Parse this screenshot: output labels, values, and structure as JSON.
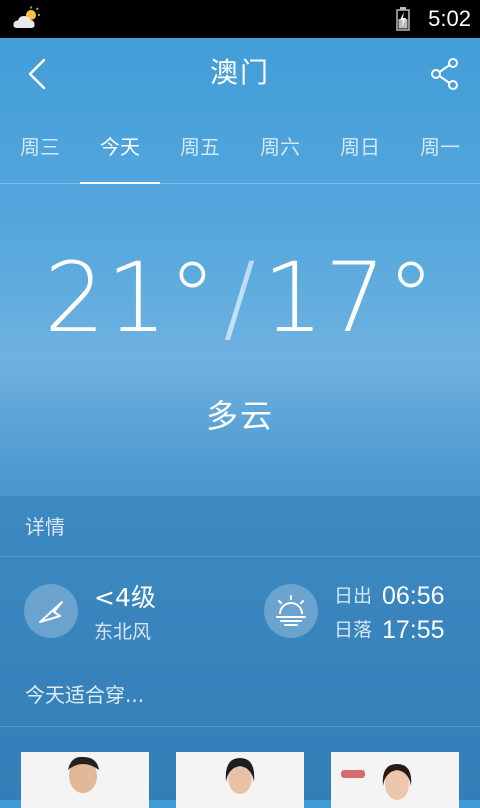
{
  "status_bar": {
    "time": "5:02",
    "weather_icon": "cloud-sun-icon",
    "battery_icon": "battery-charging-icon"
  },
  "header": {
    "city": "澳门",
    "back_icon": "back-arrow-icon",
    "share_icon": "share-icon"
  },
  "tabs": [
    {
      "label": "周三",
      "active": false
    },
    {
      "label": "今天",
      "active": true
    },
    {
      "label": "周五",
      "active": false
    },
    {
      "label": "周六",
      "active": false
    },
    {
      "label": "周日",
      "active": false
    },
    {
      "label": "周一",
      "active": false
    }
  ],
  "weather": {
    "high": "21°",
    "separator": "/",
    "low": "17°",
    "condition": "多云"
  },
  "details": {
    "title": "详情",
    "wind_level": "<4级",
    "wind_direction": "东北风",
    "sunrise_label": "日出",
    "sunrise_time": "06:56",
    "sunset_label": "日落",
    "sunset_time": "17:55"
  },
  "clothing": {
    "title": "今天适合穿..."
  },
  "colors": {
    "status_bar": "#000000",
    "background_top": "#3f9bd6",
    "background_bottom": "#3b86c0",
    "text": "#ffffff"
  }
}
